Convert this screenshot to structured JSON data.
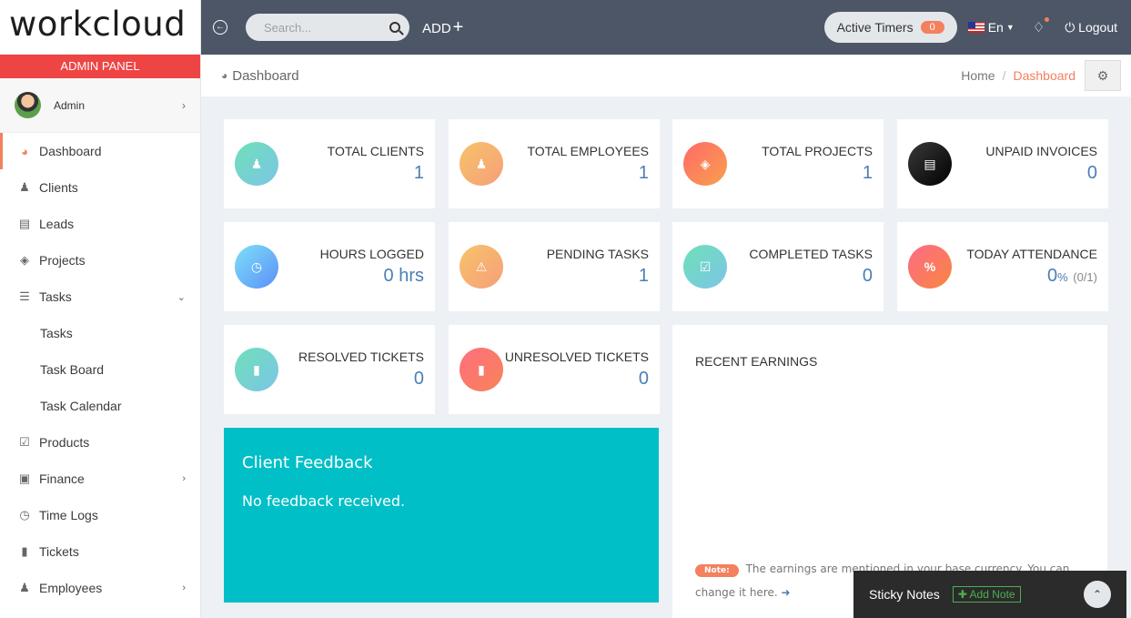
{
  "brand": "workcloud",
  "admin_panel": "ADMIN PANEL",
  "user": {
    "name": "Admin"
  },
  "sidebar": {
    "items": [
      {
        "label": "Dashboard"
      },
      {
        "label": "Clients"
      },
      {
        "label": "Leads"
      },
      {
        "label": "Projects"
      },
      {
        "label": "Tasks"
      },
      {
        "label": "Tasks"
      },
      {
        "label": "Task Board"
      },
      {
        "label": "Task Calendar"
      },
      {
        "label": "Products"
      },
      {
        "label": "Finance"
      },
      {
        "label": "Time Logs"
      },
      {
        "label": "Tickets"
      },
      {
        "label": "Employees"
      }
    ]
  },
  "topbar": {
    "search_placeholder": "Search...",
    "add_label": "ADD",
    "active_timers_label": "Active Timers",
    "active_timers_count": "0",
    "language": "En",
    "logout_label": "Logout"
  },
  "breadcrumb": {
    "title": "Dashboard",
    "home": "Home",
    "current": "Dashboard"
  },
  "cards": [
    {
      "label": "TOTAL CLIENTS",
      "value": "1"
    },
    {
      "label": "TOTAL EMPLOYEES",
      "value": "1"
    },
    {
      "label": "TOTAL PROJECTS",
      "value": "1"
    },
    {
      "label": "UNPAID INVOICES",
      "value": "0"
    },
    {
      "label": "HOURS LOGGED",
      "value": "0 hrs"
    },
    {
      "label": "PENDING TASKS",
      "value": "1"
    },
    {
      "label": "COMPLETED TASKS",
      "value": "0"
    },
    {
      "label": "TODAY ATTENDANCE",
      "value": "0",
      "unit": "%",
      "extra": "(0/1)"
    },
    {
      "label": "RESOLVED TICKETS",
      "value": "0"
    },
    {
      "label": "UNRESOLVED TICKETS",
      "value": "0"
    }
  ],
  "feedback": {
    "title": "Client Feedback",
    "message": "No feedback received."
  },
  "earnings": {
    "title": "RECENT EARNINGS",
    "note_tag": "Note:",
    "note_text": "The earnings are mentioned in your base currency. You can change it here."
  },
  "sticky": {
    "title": "Sticky Notes",
    "add_label": "Add Note"
  }
}
